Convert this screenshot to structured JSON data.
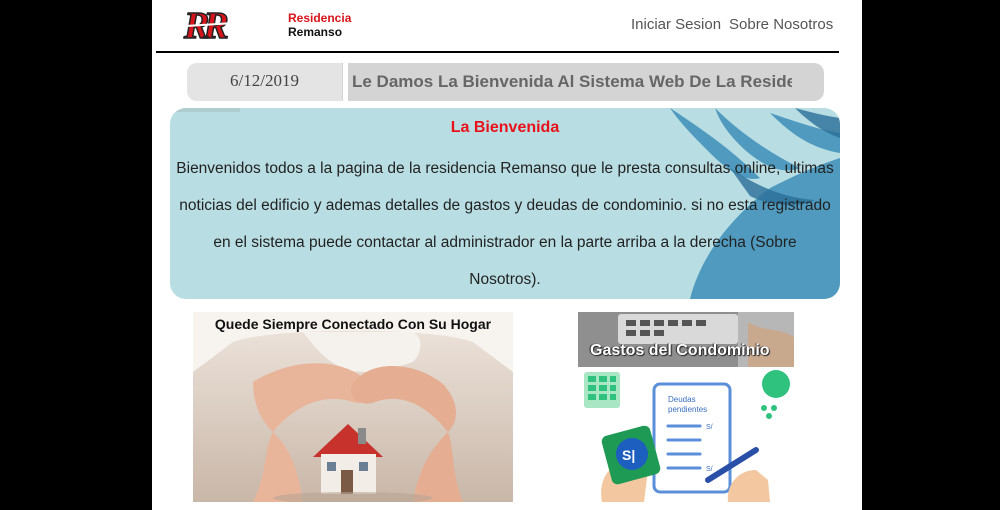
{
  "header": {
    "logo_mark": "RR",
    "logo_line1": "Residencia",
    "logo_line2": "Remanso",
    "nav": {
      "login_label": "Iniciar Sesion",
      "about_label": "Sobre Nosotros"
    }
  },
  "welcome_bar": {
    "date": "6/12/2019",
    "message": "Le Damos La Bienvenida Al Sistema Web De La Resider"
  },
  "welcome_card": {
    "title": "La Bienvenida",
    "body": "Bienvenidos todos a la pagina de la residencia Remanso que le presta consultas online, ultimas noticias del edificio y ademas detalles de gastos y deudas de condominio. si no esta registrado en el sistema puede contactar al administrador en la parte arriba a la derecha (Sobre Nosotros)."
  },
  "promos": {
    "connected_label": "Quede Siempre Conectado Con Su Hogar",
    "expenses_label": "Gastos del Condominio",
    "debts_title": "Deudas pendientes",
    "currency_symbol": "S/",
    "currency_badge": "S|"
  },
  "colors": {
    "brand_red": "#d8141b",
    "card_bg": "#b8dde3",
    "bar_bg": "#d4d4d4"
  }
}
